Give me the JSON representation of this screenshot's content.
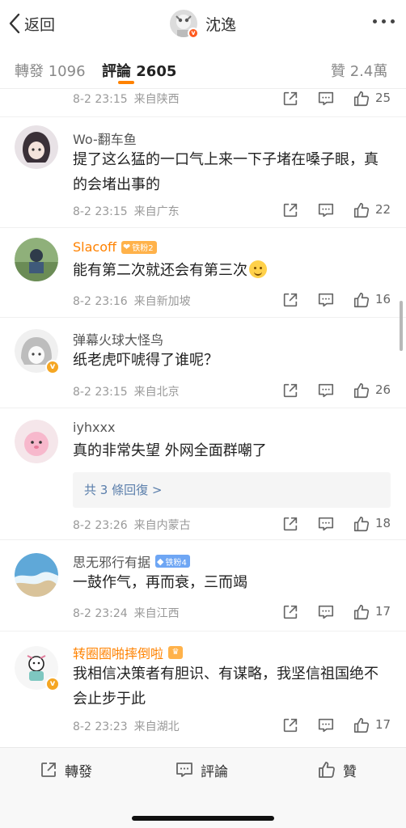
{
  "nav": {
    "back_label": "返回",
    "user_name": "沈逸"
  },
  "tabs": [
    {
      "label": "轉發 1096"
    },
    {
      "label": "評論 2605"
    },
    {
      "label": "贊 2.4萬"
    }
  ],
  "comments": [
    {
      "time": "8-2 23:15",
      "location": "来自陕西",
      "likes": "25"
    },
    {
      "user": "Wo-翻车鱼",
      "text": "提了这么猛的一口气上来一下子堵在嗓子眼，真的会堵出事的",
      "time": "8-2 23:15",
      "location": "来自广东",
      "likes": "22"
    },
    {
      "user": "Slacoff",
      "badge": "铁粉2",
      "text": "能有第二次就还会有第三次",
      "time": "8-2 23:16",
      "location": "来自新加坡",
      "likes": "16"
    },
    {
      "user": "弹幕火球大怪鸟",
      "text": "纸老虎吓唬得了谁呢？",
      "time": "8-2 23:15",
      "location": "来自北京",
      "likes": "26"
    },
    {
      "user": "iyhxxx",
      "text": "真的非常失望 外网全面群嘲了",
      "replies": "共 3 條回復 >",
      "time": "8-2 23:26",
      "location": "来自内蒙古",
      "likes": "18"
    },
    {
      "user": "思无邪行有据",
      "badge": "铁粉4",
      "text": "一鼓作气，再而衰，三而竭",
      "time": "8-2 23:24",
      "location": "来自江西",
      "likes": "17"
    },
    {
      "user": "转圈圈啪摔倒啦",
      "text": "我相信决策者有胆识、有谋略，我坚信祖国绝不会止步于此",
      "time": "8-2 23:23",
      "location": "来自湖北",
      "likes": "17"
    }
  ],
  "bottom": {
    "repost_label": "轉發",
    "comment_label": "評論",
    "like_label": "贊"
  },
  "colors": {
    "accent": "#ff8200",
    "link": "#5a7eab",
    "verified": "#f5a623"
  },
  "icons": [
    "back-chevron-icon",
    "more-dots-icon",
    "share-icon",
    "reply-icon",
    "thumbs-up-icon",
    "verified-badge-icon",
    "fan-badge-icon"
  ]
}
